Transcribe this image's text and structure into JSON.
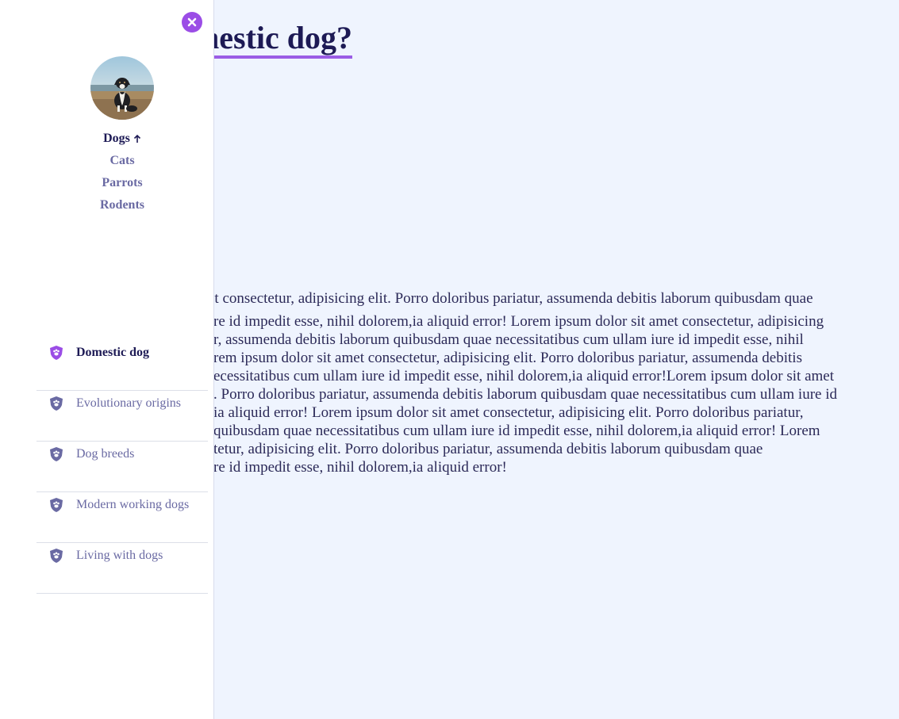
{
  "main": {
    "title": "nestic dog?",
    "body_lines": [
      "et consectetur, adipisicing elit. Porro doloribus pariatur, assumenda debitis laborum quibusdam quae",
      "re id impedit esse, nihil dolorem,ia aliquid error! Lorem ipsum dolor sit amet consectetur, adipisicing",
      "r, assumenda debitis laborum quibusdam quae necessitatibus cum ullam iure id impedit esse, nihil",
      "rem ipsum dolor sit amet consectetur, adipisicing elit. Porro doloribus pariatur, assumenda debitis",
      "ecessitatibus cum ullam iure id impedit esse, nihil dolorem,ia aliquid error!Lorem ipsum dolor sit amet",
      ". Porro doloribus pariatur, assumenda debitis laborum quibusdam quae necessitatibus cum ullam iure id",
      "ia aliquid error! Lorem ipsum dolor sit amet consectetur, adipisicing elit. Porro doloribus pariatur,",
      "quibusdam quae necessitatibus cum ullam iure id impedit esse, nihil dolorem,ia aliquid error! Lorem",
      "tetur, adipisicing elit. Porro doloribus pariatur, assumenda debitis laborum quibusdam quae",
      "re id impedit esse, nihil dolorem,ia aliquid error!"
    ]
  },
  "sidebar": {
    "close_icon": "close-icon",
    "avatar_icon": "dog-avatar",
    "categories": [
      {
        "label": "Dogs",
        "active": true
      },
      {
        "label": "Cats",
        "active": false
      },
      {
        "label": "Parrots",
        "active": false
      },
      {
        "label": "Rodents",
        "active": false
      }
    ],
    "toc": [
      {
        "label": "Domestic dog",
        "active": true
      },
      {
        "label": "Evolutionary origins",
        "active": false
      },
      {
        "label": "Dog breeds",
        "active": false
      },
      {
        "label": "Modern working dogs",
        "active": false
      },
      {
        "label": "Living with dogs",
        "active": false
      }
    ],
    "toc_icon": "paw-shield-icon"
  },
  "colors": {
    "accent": "#9b4de6",
    "text_dark": "#1d1a55",
    "text_muted": "#6a6aa3",
    "background": "#eff4fe"
  }
}
